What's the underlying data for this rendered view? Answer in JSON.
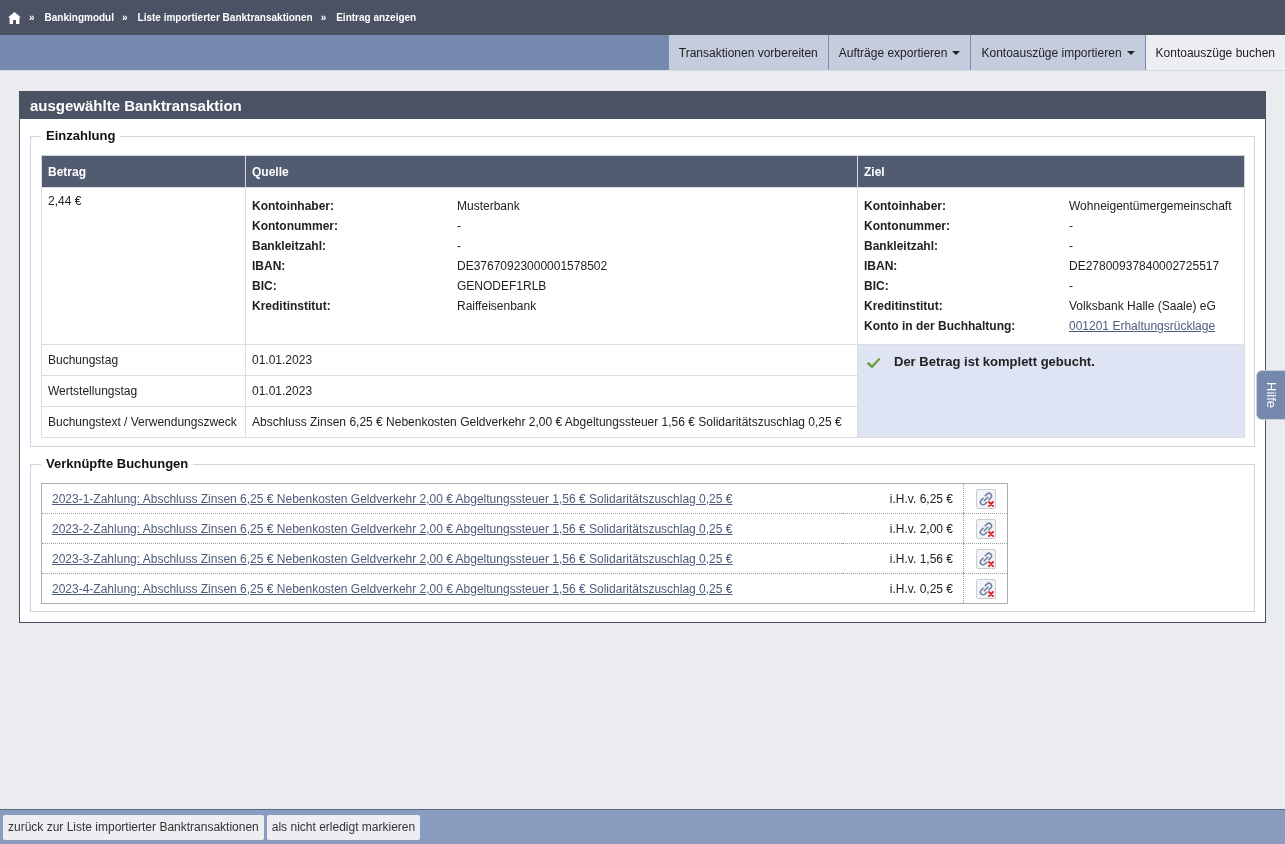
{
  "breadcrumb": {
    "items": [
      {
        "separator": "»",
        "label": "Bankingmodul"
      },
      {
        "separator": "»",
        "label": "Liste importierter Banktransaktionen"
      },
      {
        "separator": "»",
        "label": "Eintrag anzeigen"
      }
    ]
  },
  "menu": {
    "tabs": [
      {
        "label": "Transaktionen vorbereiten",
        "dropdown": false,
        "selected": false
      },
      {
        "label": "Aufträge exportieren",
        "dropdown": true,
        "selected": false
      },
      {
        "label": "Kontoauszüge importieren",
        "dropdown": true,
        "selected": false
      },
      {
        "label": "Kontoauszüge buchen",
        "dropdown": false,
        "selected": true
      }
    ]
  },
  "panel": {
    "title": "ausgewählte Banktransaktion"
  },
  "deposit": {
    "legend": "Einzahlung",
    "columns": [
      "Betrag",
      "Quelle",
      "Ziel"
    ],
    "amount": "2,44 €",
    "source": [
      {
        "label": "Kontoinhaber:",
        "value": "Musterbank",
        "kind": "text"
      },
      {
        "label": "Kontonummer:",
        "value": "-",
        "kind": "text"
      },
      {
        "label": "Bankleitzahl:",
        "value": "-",
        "kind": "text"
      },
      {
        "label": "IBAN:",
        "value": "DE37670923000001578502",
        "kind": "text"
      },
      {
        "label": "BIC:",
        "value": "GENODEF1RLB",
        "kind": "text"
      },
      {
        "label": "Kreditinstitut:",
        "value": "Raiffeisenbank",
        "kind": "text"
      }
    ],
    "target": [
      {
        "label": "Kontoinhaber:",
        "value": "Wohneigentümergemeinschaft",
        "kind": "text"
      },
      {
        "label": "Kontonummer:",
        "value": "-",
        "kind": "text"
      },
      {
        "label": "Bankleitzahl:",
        "value": "-",
        "kind": "text"
      },
      {
        "label": "IBAN:",
        "value": "DE27800937840002725517",
        "kind": "text"
      },
      {
        "label": "BIC:",
        "value": "-",
        "kind": "text"
      },
      {
        "label": "Kreditinstitut:",
        "value": "Volksbank Halle (Saale) eG",
        "kind": "text"
      },
      {
        "label": "Konto in der Buchhaltung:",
        "value": "001201 Erhaltungsrücklage",
        "kind": "link"
      }
    ],
    "rows": [
      {
        "label": "Buchungstag",
        "value": "01.01.2023"
      },
      {
        "label": "Wertstellungstag",
        "value": "01.01.2023"
      },
      {
        "label": "Buchungstext / Verwendungszweck",
        "value": "Abschluss Zinsen 6,25 € Nebenkosten Geldverkehr 2,00 € Abgeltungssteuer 1,56 € Solidaritätszuschlag 0,25 €"
      }
    ],
    "status": "Der Betrag ist komplett gebucht."
  },
  "linked": {
    "legend": "Verknüpfte Buchungen",
    "rows": [
      {
        "text": "2023-1-Zahlung: Abschluss Zinsen 6,25 € Nebenkosten Geldverkehr 2,00 € Abgeltungssteuer 1,56 € Solidaritätszuschlag 0,25 €",
        "amount": "i.H.v. 6,25 €"
      },
      {
        "text": "2023-2-Zahlung: Abschluss Zinsen 6,25 € Nebenkosten Geldverkehr 2,00 € Abgeltungssteuer 1,56 € Solidaritätszuschlag 0,25 €",
        "amount": "i.H.v. 2,00 €"
      },
      {
        "text": "2023-3-Zahlung: Abschluss Zinsen 6,25 € Nebenkosten Geldverkehr 2,00 € Abgeltungssteuer 1,56 € Solidaritätszuschlag 0,25 €",
        "amount": "i.H.v. 1,56 €"
      },
      {
        "text": "2023-4-Zahlung: Abschluss Zinsen 6,25 € Nebenkosten Geldverkehr 2,00 € Abgeltungssteuer 1,56 € Solidaritätszuschlag 0,25 €",
        "amount": "i.H.v. 0,25 €"
      }
    ]
  },
  "help": {
    "label": "Hilfe"
  },
  "footer": {
    "buttons": [
      "zurück zur Liste importierter Banktransaktionen",
      "als nicht erledigt markieren"
    ]
  }
}
